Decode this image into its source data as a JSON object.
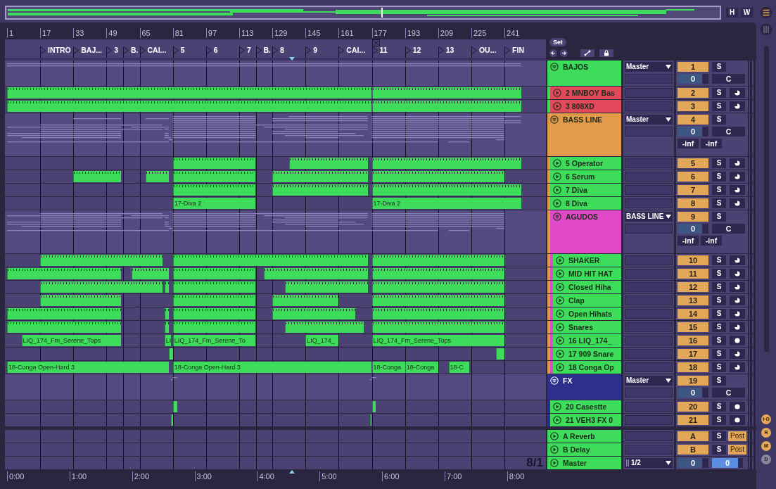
{
  "overview_buttons": [
    "H",
    "W"
  ],
  "ruler": [
    "1",
    "17",
    "33",
    "49",
    "65",
    "81",
    "97",
    "113",
    "129",
    "145",
    "161",
    "177",
    "193",
    "209",
    "225",
    "241"
  ],
  "locators": [
    {
      "label": "INTRO"
    },
    {
      "label": "BAJ..."
    },
    {
      "label": "3"
    },
    {
      "label": "B."
    },
    {
      "label": "CAI..."
    },
    {
      "label": "5"
    },
    {
      "label": "6"
    },
    {
      "label": "7"
    },
    {
      "label": "B."
    },
    {
      "label": "8"
    },
    {
      "label": "9"
    },
    {
      "label": "CAI..."
    },
    {
      "label": "11"
    },
    {
      "label": "12"
    },
    {
      "label": "13"
    },
    {
      "label": "OU..."
    },
    {
      "label": "FIN"
    }
  ],
  "set_button": "Set",
  "tracks": [
    {
      "name": "BAJOS",
      "kind": "group",
      "color": "#3ddc5a",
      "routing": "Master",
      "number": "1",
      "active": true,
      "solo": {
        "label": "S",
        "on": false
      },
      "volume": {
        "text": "0",
        "level": 0.8
      },
      "pan": "C",
      "children": [
        {
          "name": "2 MNBOY Bas",
          "kind": "track",
          "color": "#e24a5c",
          "number": "2",
          "active": true,
          "solo": {
            "label": "S",
            "on": false
          },
          "monitor": {
            "kind": "half"
          },
          "clips": [
            {
              "kind": "midi"
            },
            {
              "kind": "midi"
            }
          ]
        },
        {
          "name": "3 808XD",
          "kind": "track",
          "color": "#e24a5c",
          "number": "3",
          "active": true,
          "solo": {
            "label": "S",
            "on": false
          },
          "monitor": {
            "kind": "half"
          },
          "clips": [
            {
              "kind": "midi"
            },
            {
              "kind": "midi"
            }
          ]
        }
      ]
    },
    {
      "name": "BASS LINE",
      "kind": "group",
      "color": "#e39a4a",
      "routing": "Master",
      "number": "4",
      "active": true,
      "solo": {
        "label": "S",
        "on": false
      },
      "volume": {
        "text": "0",
        "level": 0.8
      },
      "pan": "C",
      "readings": [
        "-inf",
        "-inf"
      ],
      "children": [
        {
          "name": "5 Operator",
          "kind": "track",
          "color": "#3ddc5a",
          "number": "5",
          "active": true,
          "solo": {
            "label": "S",
            "on": false
          },
          "monitor": {
            "kind": "half"
          },
          "clips": [
            {
              "kind": "midi"
            },
            {
              "kind": "midi"
            },
            {
              "kind": "midi"
            }
          ]
        },
        {
          "name": "6 Serum",
          "kind": "track",
          "color": "#3ddc5a",
          "number": "6",
          "active": true,
          "solo": {
            "label": "S",
            "on": false
          },
          "monitor": {
            "kind": "half"
          },
          "clips": [
            {
              "kind": "midi"
            },
            {
              "kind": "midi"
            },
            {
              "kind": "midi"
            },
            {
              "kind": "midi"
            },
            {
              "kind": "midi"
            }
          ]
        },
        {
          "name": "7 Diva",
          "kind": "track",
          "color": "#3ddc5a",
          "number": "7",
          "active": true,
          "solo": {
            "label": "S",
            "on": false
          },
          "monitor": {
            "kind": "half"
          },
          "clips": [
            {
              "kind": "midi"
            },
            {
              "kind": "midi"
            },
            {
              "kind": "midi"
            }
          ]
        },
        {
          "name": "8 Diva",
          "kind": "track",
          "color": "#3ddc5a",
          "number": "8",
          "active": true,
          "solo": {
            "label": "S",
            "on": false
          },
          "monitor": {
            "kind": "half"
          },
          "clips": [
            {
              "kind": "named",
              "name": "17-Diva 2"
            },
            {
              "kind": "named",
              "name": "17-Diva 2"
            }
          ]
        },
        {
          "name": "AGUDOS",
          "kind": "group",
          "color": "#e04ac8",
          "routing": "BASS LINE",
          "number": "9",
          "active": true,
          "solo": {
            "label": "S",
            "on": false
          },
          "volume": {
            "text": "0",
            "level": 0.8
          },
          "pan": "C",
          "readings": [
            "-inf",
            "-inf"
          ],
          "children": [
            {
              "name": "SHAKER",
              "kind": "track",
              "color": "#3ddc5a",
              "number": "10",
              "active": true,
              "solo": {
                "label": "S",
                "on": false
              },
              "monitor": {
                "kind": "half"
              },
              "clips": [
                {
                  "kind": "midi"
                },
                {
                  "kind": "midi"
                },
                {
                  "kind": "midi"
                }
              ]
            },
            {
              "name": "MID HIT HAT",
              "kind": "track",
              "color": "#3ddc5a",
              "number": "11",
              "active": true,
              "solo": {
                "label": "S",
                "on": false
              },
              "monitor": {
                "kind": "half"
              },
              "clips": [
                {
                  "kind": "midi"
                },
                {
                  "kind": "midi"
                },
                {
                  "kind": "midi"
                },
                {
                  "kind": "midi"
                },
                {
                  "kind": "midi"
                }
              ]
            },
            {
              "name": "Closed Hiha",
              "kind": "track",
              "color": "#3ddc5a",
              "number": "12",
              "active": true,
              "solo": {
                "label": "S",
                "on": false
              },
              "monitor": {
                "kind": "half"
              },
              "clips": [
                {
                  "kind": "midi"
                },
                {
                  "kind": "midi"
                },
                {
                  "kind": "midi"
                },
                {
                  "kind": "midi"
                },
                {
                  "kind": "midi"
                }
              ]
            },
            {
              "name": "Clap",
              "kind": "track",
              "color": "#3ddc5a",
              "number": "13",
              "active": true,
              "solo": {
                "label": "S",
                "on": false
              },
              "monitor": {
                "kind": "half"
              },
              "clips": [
                {
                  "kind": "midi"
                },
                {
                  "kind": "midi"
                },
                {
                  "kind": "midi"
                },
                {
                  "kind": "midi"
                }
              ]
            },
            {
              "name": "Open Hihats",
              "kind": "track",
              "color": "#3ddc5a",
              "number": "14",
              "active": true,
              "solo": {
                "label": "S",
                "on": false
              },
              "monitor": {
                "kind": "half"
              },
              "clips": [
                {
                  "kind": "midi"
                },
                {
                  "kind": "midi"
                },
                {
                  "kind": "midi"
                },
                {
                  "kind": "midi"
                },
                {
                  "kind": "midi"
                }
              ]
            },
            {
              "name": "Snares",
              "kind": "track",
              "color": "#3ddc5a",
              "number": "15",
              "active": true,
              "solo": {
                "label": "S",
                "on": false
              },
              "monitor": {
                "kind": "half"
              },
              "clips": [
                {
                  "kind": "midi"
                },
                {
                  "kind": "midi"
                },
                {
                  "kind": "midi"
                },
                {
                  "kind": "midi"
                },
                {
                  "kind": "midi"
                }
              ]
            },
            {
              "name": "16 LIQ_174_",
              "kind": "track",
              "color": "#3ddc5a",
              "number": "16",
              "active": true,
              "solo": {
                "label": "S",
                "on": false
              },
              "monitor": {
                "kind": "full"
              },
              "clips": [
                {
                  "kind": "named",
                  "name": "LIQ_174_Fm_Serene_Tops"
                },
                {
                  "kind": "named",
                  "name": "LI"
                },
                {
                  "kind": "named",
                  "name": "LIQ_174_Fm_Serene_To"
                },
                {
                  "kind": "named",
                  "name": "LIQ_174_"
                },
                {
                  "kind": "named",
                  "name": "LIQ_174_Fm_Serene_Tops"
                }
              ]
            },
            {
              "name": "17 909 Snare",
              "kind": "track",
              "color": "#3ddc5a",
              "number": "17",
              "active": true,
              "solo": {
                "label": "S",
                "on": false
              },
              "monitor": {
                "kind": "half"
              },
              "clips": [
                {
                  "kind": "plain"
                },
                {
                  "kind": "plain"
                }
              ]
            },
            {
              "name": "18 Conga Op",
              "kind": "track",
              "color": "#3ddc5a",
              "number": "18",
              "active": true,
              "solo": {
                "label": "S",
                "on": false
              },
              "monitor": {
                "kind": "half"
              },
              "clips": [
                {
                  "kind": "named",
                  "name": "18-Conga Open-Hard 3"
                },
                {
                  "kind": "named",
                  "name": "18-Conga Open-Hard 3"
                },
                {
                  "kind": "named",
                  "name": "18-Conga"
                },
                {
                  "kind": "named",
                  "name": "18-Conga"
                },
                {
                  "kind": "named",
                  "name": "18-C"
                }
              ]
            }
          ]
        }
      ]
    },
    {
      "name": "FX",
      "kind": "group",
      "color": "#2c2f8c",
      "routing": "Master",
      "number": "19",
      "active": true,
      "solo": {
        "label": "S",
        "on": false
      },
      "volume": {
        "text": "0",
        "level": 0.8
      },
      "pan": "C",
      "children": [
        {
          "name": "20 Casestte",
          "kind": "track",
          "color": "#3ddc5a",
          "number": "20",
          "active": true,
          "solo": {
            "label": "S",
            "on": false
          },
          "monitor": {
            "kind": "full"
          },
          "clips": [
            {
              "kind": "plain"
            },
            {
              "kind": "plain"
            }
          ]
        },
        {
          "name": "21 VEH3 FX 0",
          "kind": "track",
          "color": "#3ddc5a",
          "number": "21",
          "active": true,
          "solo": {
            "label": "S",
            "on": false
          },
          "monitor": {
            "kind": "full"
          },
          "clips": [
            {
              "kind": "plain"
            },
            {
              "kind": "plain"
            }
          ]
        }
      ]
    }
  ],
  "returns": [
    {
      "name": "A Reverb",
      "kind": "return",
      "color": "#3ddc5a",
      "number": "A",
      "active": true,
      "solo": {
        "label": "S",
        "on": false
      },
      "send": "Post"
    },
    {
      "name": "B Delay",
      "kind": "return",
      "color": "#3ddc5a",
      "number": "B",
      "active": true,
      "solo": {
        "label": "S",
        "on": false
      },
      "send": "Post"
    },
    {
      "name": "Master",
      "kind": "master",
      "color": "#3ddc5a",
      "routing": "1/2",
      "volume": {
        "text": "0",
        "level": 0.8
      },
      "cue": {
        "text": "0",
        "level": 0.85
      }
    }
  ],
  "zoom_readout": "8/1",
  "time_ruler": [
    "0:00",
    "1:00",
    "2:00",
    "3:00",
    "4:00",
    "5:00",
    "6:00",
    "7:00",
    "8:00"
  ],
  "side_buttons": [
    "I·O",
    "R",
    "M",
    "D"
  ]
}
